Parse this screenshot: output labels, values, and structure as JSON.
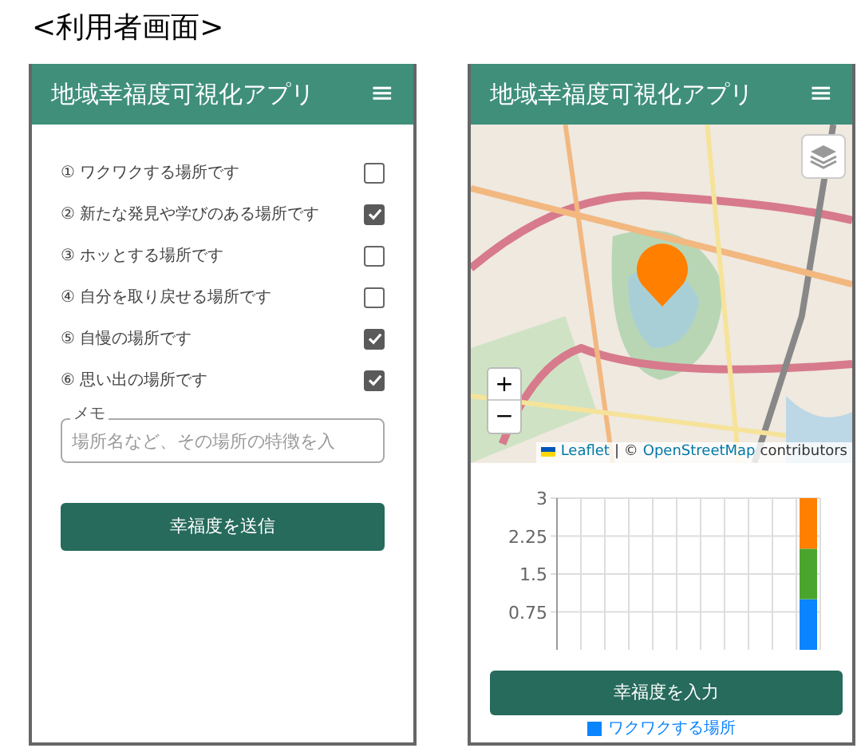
{
  "page_title": "<利用者画面>",
  "user_screen": {
    "app_title": "地域幸福度可視化アプリ",
    "menu_icon": "≡",
    "questions": [
      {
        "label": "① ワクワクする場所です",
        "checked": false
      },
      {
        "label": "② 新たな発見や学びのある場所です",
        "checked": true
      },
      {
        "label": "③ ホッとする場所です",
        "checked": false
      },
      {
        "label": "④ 自分を取り戻せる場所です",
        "checked": false
      },
      {
        "label": "⑤ 自慢の場所です",
        "checked": true
      },
      {
        "label": "⑥ 思い出の場所です",
        "checked": true
      }
    ],
    "memo": {
      "label": "メモ",
      "placeholder": "場所名など、その場所の特徴を入"
    },
    "submit_button": "幸福度を送信"
  },
  "map_screen": {
    "app_title": "地域幸福度可視化アプリ",
    "menu_icon": "≡",
    "map": {
      "kind": "picture",
      "zoom_in": "+",
      "zoom_out": "−",
      "attribution": {
        "leaflet": "Leaflet",
        "separator": "| ©",
        "osm": "OpenStreetMap",
        "suffix": "contributors"
      }
    },
    "chart": {
      "chart_data": {
        "type": "bar",
        "stacked": true,
        "grid": true,
        "ylim": [
          0,
          3
        ],
        "yticks": [
          {
            "value": 0.75,
            "label": "0.75"
          },
          {
            "value": 1.5,
            "label": "1.5"
          },
          {
            "value": 2.25,
            "label": "2.25"
          },
          {
            "value": 3,
            "label": "3"
          }
        ],
        "series": [
          {
            "name": "ワクワクする場所",
            "color": "#0a84ff",
            "values": [
              null,
              null,
              null,
              null,
              null,
              null,
              null,
              null,
              null,
              null,
              1
            ]
          },
          {
            "color": "#4aa52e",
            "values": [
              null,
              null,
              null,
              null,
              null,
              null,
              null,
              null,
              null,
              null,
              1
            ]
          },
          {
            "color": "#ff8000",
            "values": [
              null,
              null,
              null,
              null,
              null,
              null,
              null,
              null,
              null,
              null,
              1
            ]
          }
        ]
      }
    },
    "input_button": "幸福度を入力"
  }
}
